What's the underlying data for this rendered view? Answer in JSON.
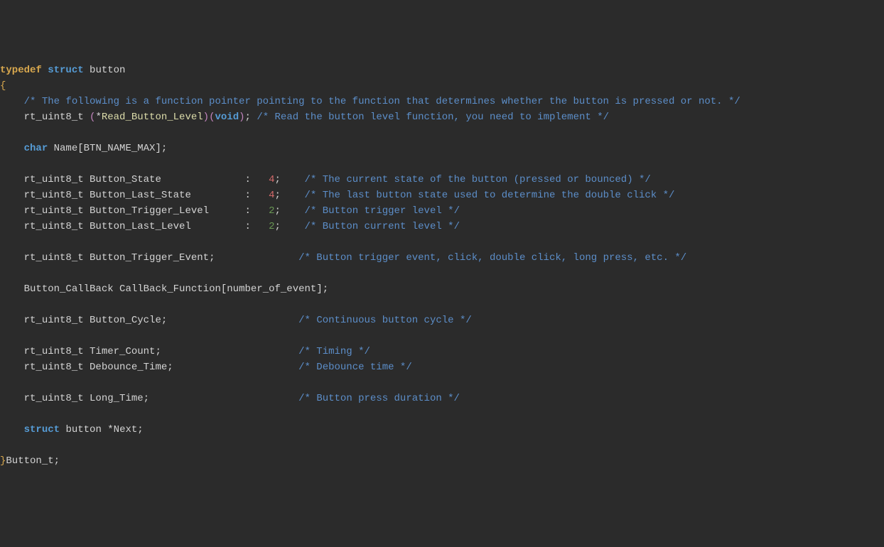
{
  "code": {
    "l1_typedef": "typedef",
    "l1_struct": "struct",
    "l1_name": "button",
    "l2_brace": "{",
    "l3_comment": "/* The following is a function pointer pointing to the function that determines whether the button is pressed or not. */",
    "l4_type": "rt_uint8_t",
    "l4_lp": "(",
    "l4_star": "*",
    "l4_fn": "Read_Button_Level",
    "l4_rp": ")",
    "l4_lp2": "(",
    "l4_void": "void",
    "l4_rp2": ")",
    "l4_semi": ";",
    "l4_comment": "/* Read the button level function, you need to implement */",
    "l6_char": "char",
    "l6_name": "Name",
    "l6_lb": "[",
    "l6_const": "BTN_NAME_MAX",
    "l6_rb": "]",
    "l6_semi": ";",
    "l8_type": "rt_uint8_t",
    "l8_field": "Button_State",
    "l8_colon": ":",
    "l8_num": "4",
    "l8_semi": ";",
    "l8_comment": "/* The current state of the button (pressed or bounced) */",
    "l9_type": "rt_uint8_t",
    "l9_field": "Button_Last_State",
    "l9_colon": ":",
    "l9_num": "4",
    "l9_semi": ";",
    "l9_comment": "/* The last button state used to determine the double click */",
    "l10_type": "rt_uint8_t",
    "l10_field": "Button_Trigger_Level",
    "l10_colon": ":",
    "l10_num": "2",
    "l10_semi": ";",
    "l10_comment": "/* Button trigger level */",
    "l11_type": "rt_uint8_t",
    "l11_field": "Button_Last_Level",
    "l11_colon": ":",
    "l11_num": "2",
    "l11_semi": ";",
    "l11_comment": "/* Button current level */",
    "l13_type": "rt_uint8_t",
    "l13_field": "Button_Trigger_Event",
    "l13_semi": ";",
    "l13_comment": "/* Button trigger event, click, double click, long press, etc. */",
    "l15_type": "Button_CallBack",
    "l15_field": "CallBack_Function",
    "l15_lb": "[",
    "l15_const": "number_of_event",
    "l15_rb": "]",
    "l15_semi": ";",
    "l17_type": "rt_uint8_t",
    "l17_field": "Button_Cycle",
    "l17_semi": ";",
    "l17_comment": "/* Continuous button cycle */",
    "l19_type": "rt_uint8_t",
    "l19_field": "Timer_Count",
    "l19_semi": ";",
    "l19_comment": "/* Timing */",
    "l20_type": "rt_uint8_t",
    "l20_field": "Debounce_Time",
    "l20_semi": ";",
    "l20_comment": "/* Debounce time */",
    "l22_type": "rt_uint8_t",
    "l22_field": "Long_Time",
    "l22_semi": ";",
    "l22_comment": "/* Button press duration */",
    "l24_struct": "struct",
    "l24_name": "button",
    "l24_star": "*",
    "l24_field": "Next",
    "l24_semi": ";",
    "l26_brace": "}",
    "l26_alias": "Button_t",
    "l26_semi": ";"
  }
}
